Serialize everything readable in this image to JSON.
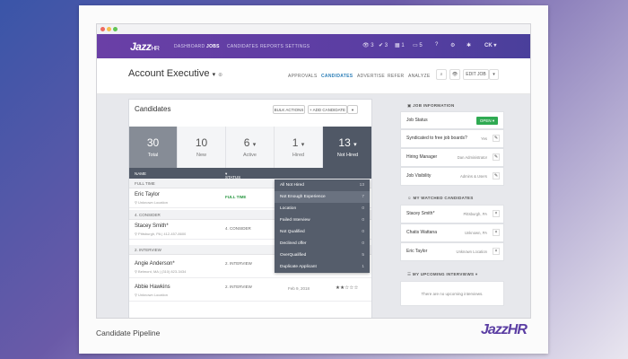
{
  "brand": {
    "logo": "JazzHR",
    "caption": "Candidate Pipeline"
  },
  "nav": {
    "logo": "Jazz",
    "logo_suffix": "HR",
    "items": [
      "DASHBOARD",
      "JOBS",
      "CANDIDATES",
      "REPORTS",
      "SETTINGS"
    ],
    "icons": [
      {
        "name": "eye-icon",
        "glyph": "👁",
        "count": "3"
      },
      {
        "name": "check-icon",
        "glyph": "✔",
        "count": "3"
      },
      {
        "name": "calendar-icon",
        "glyph": "▦",
        "count": "1"
      },
      {
        "name": "inbox-icon",
        "glyph": "▭",
        "count": "5"
      }
    ],
    "user": "CK"
  },
  "job": {
    "title": "Account Executive"
  },
  "subtabs": [
    "APPROVALS",
    "CANDIDATES",
    "ADVERTISE",
    "REFER",
    "ANALYZE"
  ],
  "edit_job": "EDIT JOB",
  "candidates": {
    "title": "Candidates",
    "bulk_actions": "BULK ACTIONS",
    "add_candidate": "+ ADD CANDIDATE",
    "stats": [
      {
        "num": "30",
        "label": "Total"
      },
      {
        "num": "10",
        "label": "New"
      },
      {
        "num": "6",
        "label": "Active"
      },
      {
        "num": "1",
        "label": "Hired"
      },
      {
        "num": "13",
        "label": "Not Hired"
      }
    ],
    "headers": {
      "name": "NAME",
      "status": "STATUS"
    },
    "groups": [
      "FULL TIME",
      "4. CONSIDER",
      "2. INTERVIEW"
    ],
    "rows": [
      {
        "name": "Eric Taylor",
        "location": "Unknown Location",
        "status": "FULL TIME",
        "date": "",
        "stars": ""
      },
      {
        "name": "Stacey Smith*",
        "location": "Pittsburgh, PA | 412-457-8600",
        "status": "4. CONSIDER",
        "date": "",
        "stars": ""
      },
      {
        "name": "Angie Anderson*",
        "location": "Belmont, MA | (310) 823-3434",
        "status": "2. INTERVIEW",
        "date": "Mar 7, 2018",
        "stars": "★★★★★"
      },
      {
        "name": "Abbie Hawkins",
        "location": "Unknown Location",
        "status": "2. INTERVIEW",
        "date": "Feb 9, 2018",
        "stars": "★★☆☆☆"
      }
    ],
    "dropdown": [
      {
        "label": "All Not Hired",
        "count": "13"
      },
      {
        "label": "Not Enough Experience",
        "count": "7"
      },
      {
        "label": "Location",
        "count": "0"
      },
      {
        "label": "Failed Interview",
        "count": "0"
      },
      {
        "label": "Not Qualified",
        "count": "0"
      },
      {
        "label": "Declined offer",
        "count": "0"
      },
      {
        "label": "OverQualified",
        "count": "5"
      },
      {
        "label": "Duplicate Applicant",
        "count": "1"
      }
    ]
  },
  "sidebar": {
    "job_info_title": "JOB INFORMATION",
    "job_status_label": "Job Status",
    "job_status_value": "OPEN",
    "info": [
      {
        "label": "Syndicated to free job boards?",
        "value": "Yes"
      },
      {
        "label": "Hiring Manager",
        "value": "Dan Administrator"
      },
      {
        "label": "Job Visibility",
        "value": "Admins & Users"
      }
    ],
    "watched_title": "MY WATCHED CANDIDATES",
    "watched": [
      {
        "name": "Stacey Smith*",
        "location": "Pittsburgh, PA"
      },
      {
        "name": "Chatis Wattana",
        "location": "Unknown, PA"
      },
      {
        "name": "Eric Taylor",
        "location": "Unknown Location"
      }
    ],
    "interviews_title": "MY UPCOMING INTERVIEWS",
    "interviews_empty": "There are no upcoming interviews."
  },
  "colors": {
    "nav": "#5b3ea3",
    "accent": "#2d7fb8",
    "success": "#2faa52",
    "dropdown": "#555d6b"
  }
}
